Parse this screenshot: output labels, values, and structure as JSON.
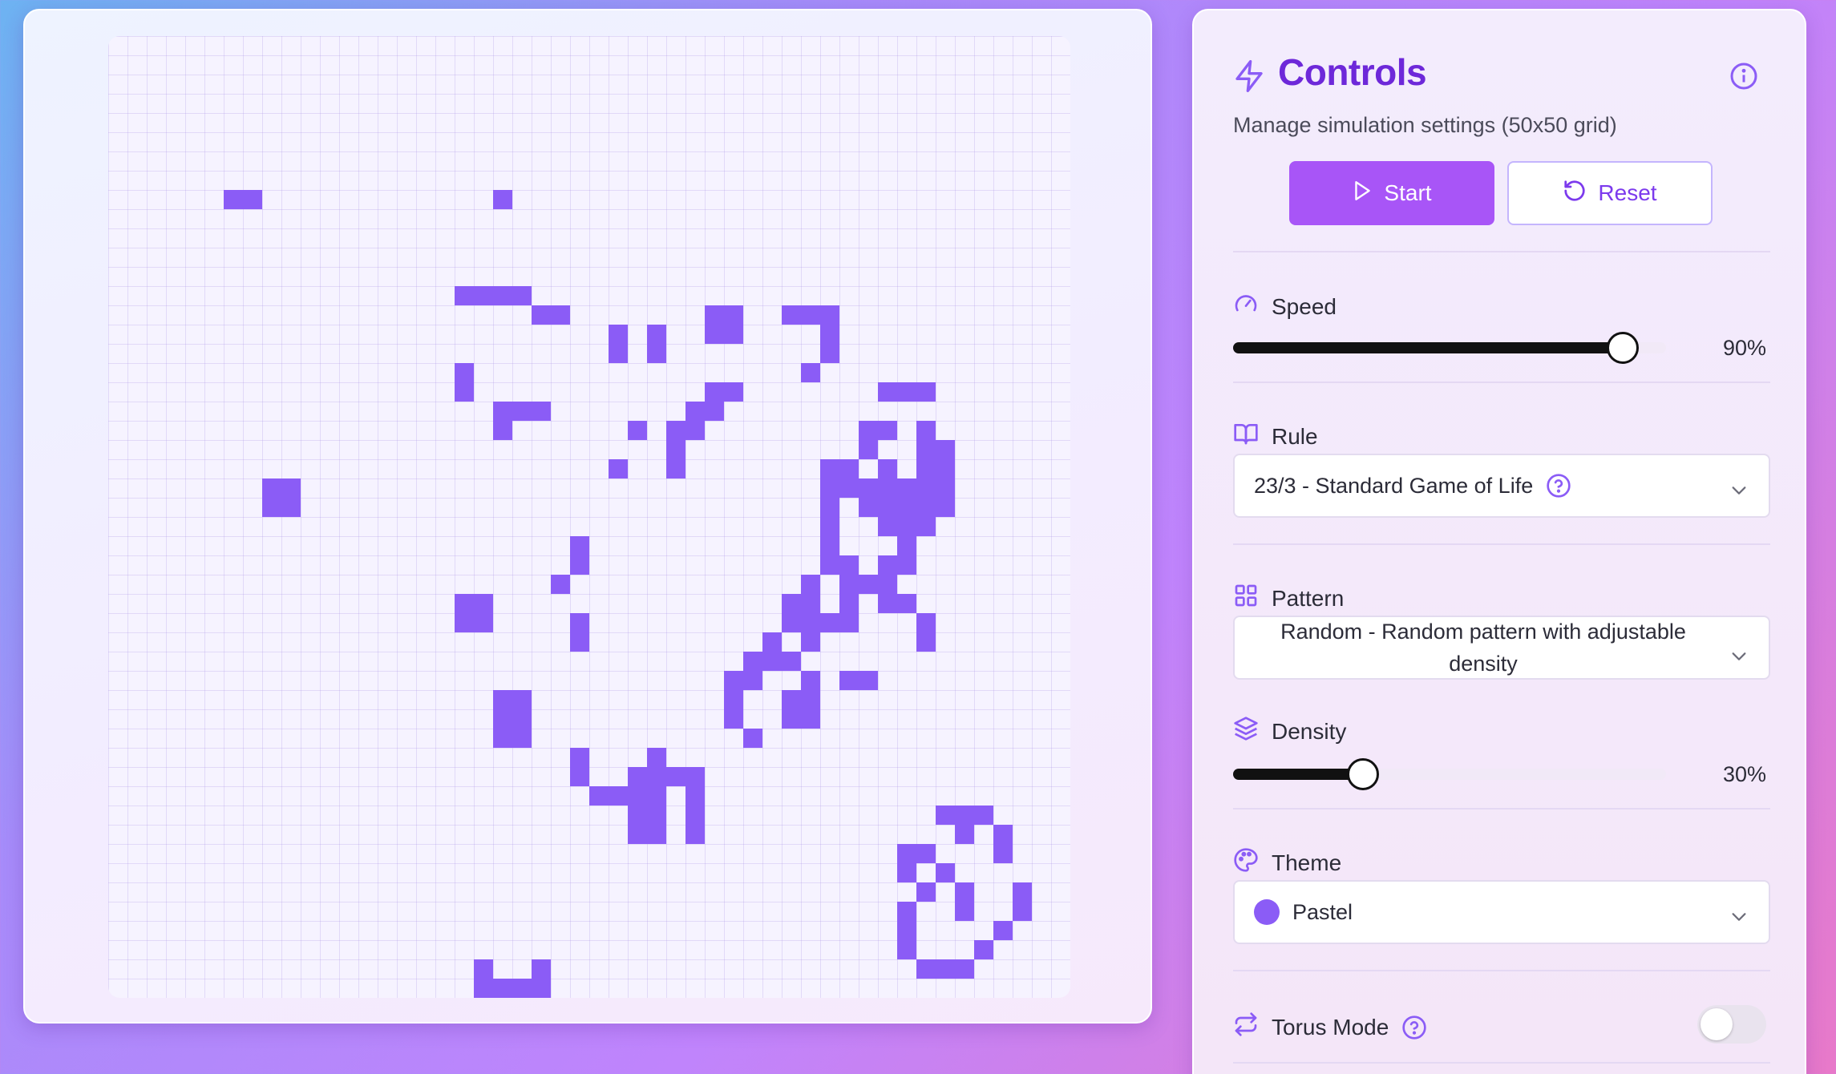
{
  "board": {
    "rows": 50,
    "cols": 50,
    "alive_color": "#8b5cf6",
    "alive_cells": [
      [
        8,
        20
      ],
      [
        8,
        7
      ],
      [
        8,
        6
      ],
      [
        13,
        18
      ],
      [
        13,
        19
      ],
      [
        13,
        20
      ],
      [
        13,
        21
      ],
      [
        14,
        22
      ],
      [
        14,
        23
      ],
      [
        14,
        31
      ],
      [
        14,
        32
      ],
      [
        14,
        35
      ],
      [
        14,
        36
      ],
      [
        14,
        37
      ],
      [
        15,
        26
      ],
      [
        15,
        28
      ],
      [
        15,
        31
      ],
      [
        15,
        32
      ],
      [
        15,
        37
      ],
      [
        16,
        26
      ],
      [
        16,
        28
      ],
      [
        16,
        37
      ],
      [
        17,
        18
      ],
      [
        17,
        36
      ],
      [
        18,
        18
      ],
      [
        18,
        31
      ],
      [
        18,
        32
      ],
      [
        18,
        40
      ],
      [
        18,
        41
      ],
      [
        18,
        42
      ],
      [
        19,
        20
      ],
      [
        19,
        21
      ],
      [
        19,
        22
      ],
      [
        19,
        31
      ],
      [
        19,
        30
      ],
      [
        20,
        20
      ],
      [
        20,
        27
      ],
      [
        20,
        29
      ],
      [
        20,
        30
      ],
      [
        20,
        39
      ],
      [
        20,
        40
      ],
      [
        20,
        42
      ],
      [
        21,
        29
      ],
      [
        21,
        39
      ],
      [
        21,
        42
      ],
      [
        21,
        43
      ],
      [
        22,
        26
      ],
      [
        22,
        29
      ],
      [
        22,
        37
      ],
      [
        22,
        38
      ],
      [
        22,
        40
      ],
      [
        22,
        43
      ],
      [
        23,
        37
      ],
      [
        23,
        38
      ],
      [
        23,
        39
      ],
      [
        23,
        40
      ],
      [
        23,
        41
      ],
      [
        23,
        42
      ],
      [
        23,
        43
      ],
      [
        22,
        42
      ],
      [
        23,
        8
      ],
      [
        23,
        9
      ],
      [
        24,
        8
      ],
      [
        24,
        9
      ],
      [
        24,
        37
      ],
      [
        24,
        39
      ],
      [
        24,
        41
      ],
      [
        24,
        42
      ],
      [
        25,
        37
      ],
      [
        26,
        37
      ],
      [
        26,
        41
      ],
      [
        24,
        40
      ],
      [
        25,
        40
      ],
      [
        25,
        41
      ],
      [
        25,
        42
      ],
      [
        24,
        43
      ],
      [
        26,
        24
      ],
      [
        27,
        24
      ],
      [
        27,
        37
      ],
      [
        27,
        38
      ],
      [
        27,
        40
      ],
      [
        27,
        41
      ],
      [
        28,
        23
      ],
      [
        28,
        36
      ],
      [
        28,
        38
      ],
      [
        28,
        39
      ],
      [
        28,
        40
      ],
      [
        29,
        35
      ],
      [
        29,
        36
      ],
      [
        29,
        38
      ],
      [
        29,
        40
      ],
      [
        29,
        41
      ],
      [
        29,
        18
      ],
      [
        29,
        19
      ],
      [
        30,
        18
      ],
      [
        30,
        19
      ],
      [
        30,
        35
      ],
      [
        30,
        36
      ],
      [
        30,
        37
      ],
      [
        30,
        38
      ],
      [
        30,
        42
      ],
      [
        30,
        24
      ],
      [
        31,
        24
      ],
      [
        31,
        34
      ],
      [
        31,
        36
      ],
      [
        31,
        42
      ],
      [
        32,
        33
      ],
      [
        32,
        34
      ],
      [
        31,
        36
      ],
      [
        32,
        35
      ],
      [
        33,
        32
      ],
      [
        33,
        33
      ],
      [
        33,
        36
      ],
      [
        33,
        38
      ],
      [
        33,
        39
      ],
      [
        34,
        32
      ],
      [
        35,
        32
      ],
      [
        34,
        35
      ],
      [
        35,
        35
      ],
      [
        35,
        36
      ],
      [
        36,
        33
      ],
      [
        34,
        20
      ],
      [
        34,
        21
      ],
      [
        35,
        20
      ],
      [
        35,
        21
      ],
      [
        35,
        32
      ],
      [
        35,
        36
      ],
      [
        34,
        36
      ],
      [
        36,
        20
      ],
      [
        36,
        21
      ],
      [
        37,
        24
      ],
      [
        38,
        24
      ],
      [
        38,
        27
      ],
      [
        38,
        28
      ],
      [
        37,
        28
      ],
      [
        39,
        25
      ],
      [
        38,
        29
      ],
      [
        39,
        26
      ],
      [
        39,
        27
      ],
      [
        39,
        28
      ],
      [
        38,
        30
      ],
      [
        39,
        30
      ],
      [
        40,
        27
      ],
      [
        40,
        28
      ],
      [
        40,
        30
      ],
      [
        41,
        27
      ],
      [
        41,
        28
      ],
      [
        41,
        30
      ],
      [
        36,
        20
      ],
      [
        40,
        43
      ],
      [
        40,
        44
      ],
      [
        40,
        45
      ],
      [
        41,
        44
      ],
      [
        41,
        46
      ],
      [
        42,
        41
      ],
      [
        42,
        42
      ],
      [
        42,
        46
      ],
      [
        43,
        41
      ],
      [
        43,
        43
      ],
      [
        44,
        42
      ],
      [
        44,
        44
      ],
      [
        44,
        47
      ],
      [
        45,
        41
      ],
      [
        45,
        44
      ],
      [
        45,
        47
      ],
      [
        46,
        41
      ],
      [
        46,
        46
      ],
      [
        47,
        41
      ],
      [
        47,
        45
      ],
      [
        48,
        42
      ],
      [
        48,
        43
      ],
      [
        48,
        44
      ],
      [
        49,
        19
      ],
      [
        49,
        20
      ],
      [
        49,
        21
      ],
      [
        49,
        22
      ],
      [
        48,
        19
      ],
      [
        48,
        22
      ]
    ]
  },
  "panel": {
    "title": "Controls",
    "subtitle": "Manage simulation settings (50x50 grid)",
    "start_label": "Start",
    "reset_label": "Reset",
    "speed": {
      "label": "Speed",
      "value": 0.9,
      "value_text": "90%"
    },
    "rule": {
      "label": "Rule",
      "selected": "23/3 - Standard Game of Life"
    },
    "pattern": {
      "label": "Pattern",
      "selected": "Random - Random pattern with adjustable density"
    },
    "density": {
      "label": "Density",
      "value": 0.3,
      "value_text": "30%"
    },
    "theme": {
      "label": "Theme",
      "selected": "Pastel",
      "swatch_color": "#8b5cf6"
    },
    "torus": {
      "label": "Torus Mode",
      "enabled": false
    },
    "accent_color": "#7c3aed"
  }
}
